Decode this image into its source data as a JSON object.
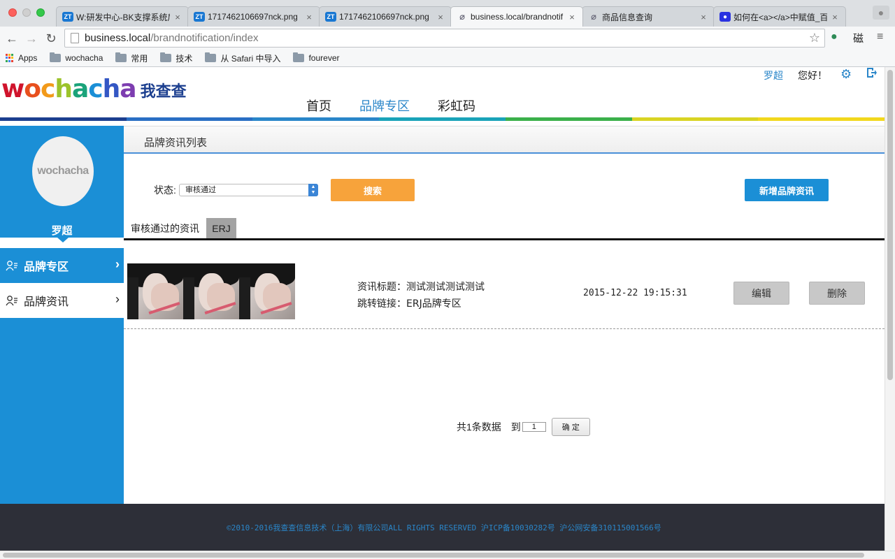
{
  "browser": {
    "tabs": [
      {
        "icon": "ZT",
        "title": "W:研发中心-BK支撑系统后台"
      },
      {
        "icon": "ZT",
        "title": "1717462106697nck.png"
      },
      {
        "icon": "ZT",
        "title": "1717462106697nck.png"
      },
      {
        "icon": "clip",
        "title": "business.local/brandnotif"
      },
      {
        "icon": "clip",
        "title": "商品信息查询"
      },
      {
        "icon": "paw",
        "title": "如何在<a></a>中赋值_百度"
      }
    ],
    "tab_close": "×",
    "url_host": "business.local",
    "url_path": "/brandnotification/index",
    "bookmarks": [
      "Apps",
      "wochacha",
      "常用",
      "技术",
      "从 Safari 中导入",
      "fourever"
    ],
    "ext_label": "磁"
  },
  "site": {
    "logo_word": "wochacha",
    "logo_cn": "我查查",
    "user_name": "罗超",
    "greeting": "您好！",
    "nav": [
      "首页",
      "品牌专区",
      "彩虹码"
    ],
    "nav_current_index": 1,
    "rainbow_colors": [
      "#1c3f8f",
      "#2a6fc4",
      "#2a86c9",
      "#1aa3b8",
      "#3bb04a",
      "#d9d423",
      "#f2d81e"
    ]
  },
  "sidebar": {
    "avatar_text": "wochacha",
    "username": "罗超",
    "items": [
      {
        "label": "品牌专区",
        "active": true
      },
      {
        "label": "品牌资讯",
        "active": false
      }
    ]
  },
  "content": {
    "title": "品牌资讯列表",
    "filter_label": "状态:",
    "status_value": "审核通过",
    "search_label": "搜索",
    "add_label": "新增品牌资讯",
    "tabs": [
      "审核通过的资讯",
      "ERJ"
    ],
    "item": {
      "title": "资讯标题：测试测试测试测试",
      "link": "跳转链接：ERJ品牌专区",
      "date": "2015-12-22 19:15:31",
      "edit": "编辑",
      "delete": "删除"
    },
    "pager": {
      "total": "共1条数据",
      "goto": "到",
      "page": "1",
      "confirm": "确 定"
    }
  },
  "footer": {
    "text": "©2010-2016我查查信息技术（上海）有限公司ALL RIGHTS RESERVED 沪ICP备10030282号 沪公网安备310115001566号"
  }
}
